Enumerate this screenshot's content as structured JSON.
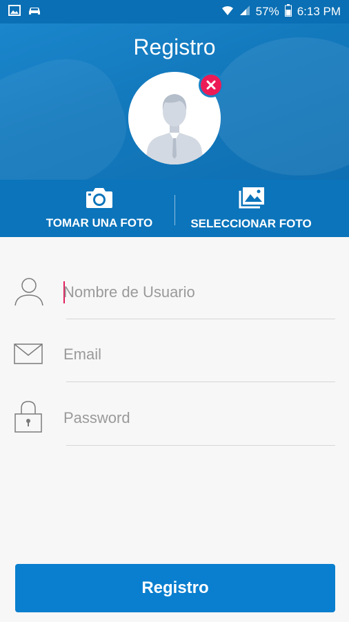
{
  "status_bar": {
    "battery_percent": "57%",
    "time": "6:13 PM",
    "icons": [
      "image-icon",
      "car-icon",
      "wifi-icon",
      "signal-icon",
      "battery-icon"
    ]
  },
  "header": {
    "title": "Registro",
    "avatar_icon": "person-placeholder-icon",
    "remove_icon": "close-icon"
  },
  "photo_actions": {
    "take_photo": {
      "label": "TOMAR UNA FOTO",
      "icon": "camera-icon"
    },
    "select_photo": {
      "label": "SELECCIONAR FOTO",
      "icon": "gallery-icon"
    }
  },
  "form": {
    "username": {
      "placeholder": "Nombre de Usuario",
      "value": "",
      "icon": "user-icon"
    },
    "email": {
      "placeholder": "Email",
      "value": "",
      "icon": "envelope-icon"
    },
    "password": {
      "placeholder": "Password",
      "value": "",
      "icon": "lock-icon"
    }
  },
  "submit_label": "Registro",
  "colors": {
    "primary": "#0a7fcf",
    "header": "#1379bd",
    "accent_red": "#ec1b56",
    "background": "#f7f7f7"
  }
}
